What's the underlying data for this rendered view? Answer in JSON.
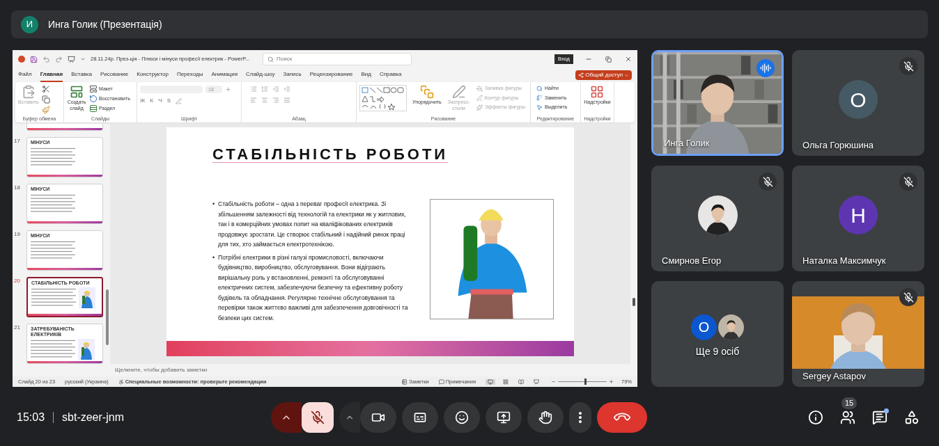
{
  "meeting_header": {
    "avatar_letter": "И",
    "title": "Инга Голик (Презентація)"
  },
  "presentation": {
    "title_bar": {
      "document_title": "28.11.24р. През-ція - Плюси і мінуси професії електрик  -  PowerP...",
      "search_placeholder": "Поиск",
      "sign_in": "Вход"
    },
    "menu_tabs": [
      {
        "label": "Файл",
        "selected": false
      },
      {
        "label": "Главная",
        "selected": true
      },
      {
        "label": "Вставка",
        "selected": false
      },
      {
        "label": "Рисование",
        "selected": false
      },
      {
        "label": "Конструктор",
        "selected": false
      },
      {
        "label": "Переходы",
        "selected": false
      },
      {
        "label": "Анимация",
        "selected": false
      },
      {
        "label": "Слайд-шоу",
        "selected": false
      },
      {
        "label": "Запись",
        "selected": false
      },
      {
        "label": "Рецензирование",
        "selected": false
      },
      {
        "label": "Вид",
        "selected": false
      },
      {
        "label": "Справка",
        "selected": false
      }
    ],
    "share_button": "Общий доступ",
    "ribbon": [
      {
        "kind": "clipboard",
        "label": "Буфер обмена",
        "paste": {
          "label": "Вставить",
          "disabled": true
        }
      },
      {
        "kind": "slides",
        "label": "Слайды",
        "new_slide": "Создать слайд",
        "layout": "Макет",
        "reset": "Восстановить",
        "section": "Раздел"
      },
      {
        "kind": "font",
        "label": "Шрифт",
        "font_size": "18",
        "style_buttons": [
          "Ж",
          "К",
          "Ч",
          "S"
        ]
      },
      {
        "kind": "paragraph",
        "label": "Абзац"
      },
      {
        "kind": "drawing",
        "label": "Рисование",
        "arrange": "Упорядочить",
        "quick_styles": {
          "label": "Экспресс-стили",
          "disabled": true
        },
        "shape_commands": [
          {
            "label": "Заливка фигуры",
            "disabled": true
          },
          {
            "label": "Контур фигуры",
            "disabled": true
          },
          {
            "label": "Эффекты фигуры",
            "disabled": true
          }
        ]
      },
      {
        "kind": "editing",
        "label": "Редактирование",
        "commands": [
          "Найти",
          "Заменить",
          "Выделить"
        ]
      },
      {
        "kind": "addins",
        "label": "Надстройки",
        "button": "Надстройки"
      }
    ],
    "thumbnails": [
      {
        "kind": "partial",
        "selected": false
      },
      {
        "kind": "full",
        "number": "17",
        "title": "МІНУСИ",
        "selected": false,
        "has_image": false
      },
      {
        "kind": "full",
        "number": "18",
        "title": "МІНУСИ",
        "selected": false,
        "has_image": false
      },
      {
        "kind": "full",
        "number": "19",
        "title": "МІНУСИ",
        "selected": false,
        "has_image": false
      },
      {
        "kind": "full",
        "number": "20",
        "title": "СТАБІЛЬНІСТЬ РОБОТИ",
        "selected": true,
        "has_image": true
      },
      {
        "kind": "full",
        "number": "21",
        "title": "ЗАТРЕБУВАНІСТЬ ЕЛЕКТРИКІВ",
        "selected": false,
        "has_image": true
      }
    ],
    "slide": {
      "title": "СТАБІЛЬНІСТЬ РОБОТИ",
      "bullets": [
        {
          "mark": "•",
          "text": "Стабільність роботи – одна з переваг професії електрика. Зі збільшенням залежності від технологій та електрики як у житлових, так і в комерційних умовах попит на кваліфікованих електриків продовжує зростати. Це створює стабільний і надійний ринок праці для тих, хто займається електротехнікою."
        },
        {
          "mark": "•",
          "text": "Потрібні електрики в різні галузі промисловості, включаючи будівництво, виробництво, обслуговування. Вони відіграють вирішальну роль у встановленні, ремонті та обслуговуванні електричних систем, забезпечуючи безпечну та ефективну роботу будівель та обладнання. Регулярне технічне обслуговування та перевірки також життєво важливі для забезпечення довговічності та безпеки цих систем."
        }
      ]
    },
    "notes_placeholder": "Щелкните, чтобы добавить заметки",
    "status_bar": {
      "slide_position": "Слайд 20 из 23",
      "language": "русский (Украина)",
      "accessibility": "Специальные возможности: проверьте рекомендации",
      "notes": "Заметки",
      "comments": "Примечания",
      "views": [
        {
          "selected": true
        },
        {
          "selected": false
        },
        {
          "selected": false
        },
        {
          "selected": false
        }
      ],
      "zoom": {
        "level": 0.55
      },
      "zoom_reading": "79%"
    }
  },
  "tiles": [
    {
      "kind": "video",
      "name": "Инга Голик",
      "speaking": true,
      "muted": false
    },
    {
      "kind": "letter",
      "name": "Ольга Горюшина",
      "letter": "О",
      "color": "#455a64",
      "speaking": false,
      "muted": true
    },
    {
      "name": "Смирнов Егор",
      "speaking": false,
      "muted": true
    },
    {
      "kind": "letter",
      "name": "Наталка Максимчук",
      "letter": "Н",
      "color": "#5e35b1",
      "speaking": false,
      "muted": true
    },
    {
      "kind": "others",
      "name": "Ще 9 осіб",
      "letter": "О",
      "color": "#0b57d0",
      "speaking": false,
      "muted": false
    },
    {
      "kind": "video2",
      "name": "Sergey Astapov",
      "speaking": false,
      "muted": true
    }
  ],
  "call_bar": {
    "time": "15:03",
    "meeting_code": "sbt-zeer-jnm",
    "mic": {
      "muted": true
    },
    "people_count": "15",
    "chat_unread": true
  }
}
